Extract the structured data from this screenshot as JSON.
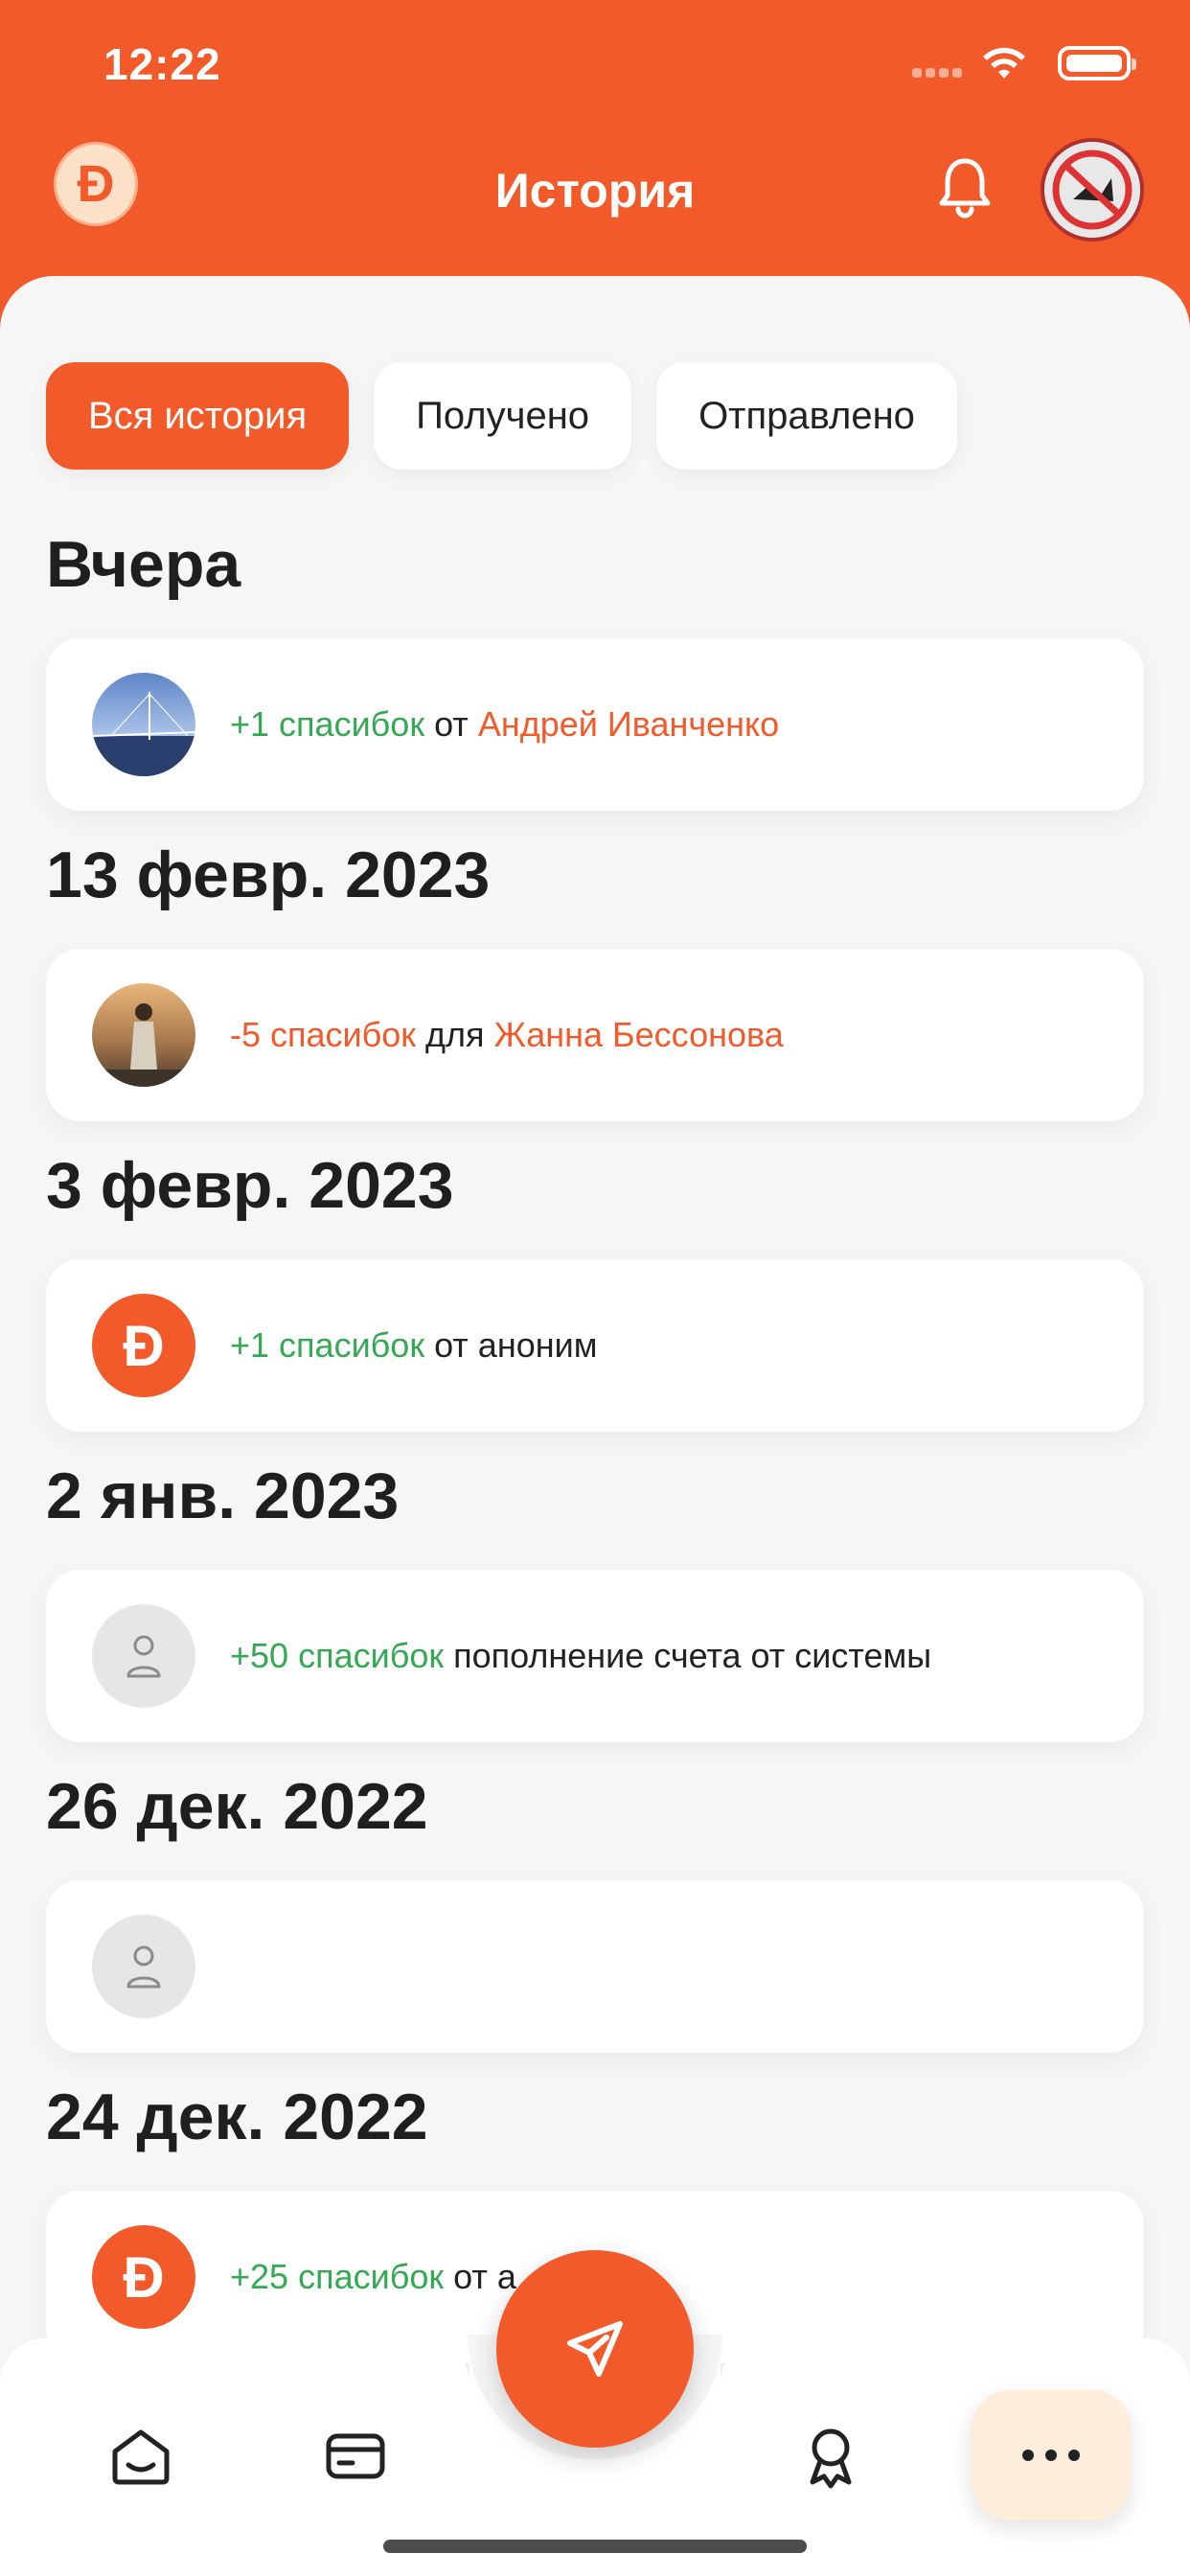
{
  "status": {
    "time": "12:22"
  },
  "header": {
    "title": "История",
    "logo_letter": "Đ"
  },
  "filters": [
    {
      "label": "Вся история",
      "active": true
    },
    {
      "label": "Получено",
      "active": false
    },
    {
      "label": "Отправлено",
      "active": false
    }
  ],
  "history": [
    {
      "date": "Вчера",
      "amount": "+1 спасибок",
      "prep": "от",
      "name": "Андрей Иванченко"
    },
    {
      "date": "13 февр. 2023",
      "amount": "-5 спасибок",
      "prep": "для",
      "name": "Жанна Бессонова"
    },
    {
      "date": "3 февр. 2023",
      "amount": "+1 спасибок",
      "prep": "от аноним",
      "name": ""
    },
    {
      "date": "2 янв. 2023",
      "amount": "+50 спасибок",
      "prep": "пополнение счета от системы",
      "name": ""
    },
    {
      "date": "26 дек. 2022",
      "amount": "",
      "prep": "",
      "name": ""
    },
    {
      "date": "24 дек. 2022",
      "amount": "+25 спасибок",
      "prep": "от а",
      "name": ""
    }
  ],
  "colors": {
    "accent": "#F25A2A",
    "positive": "#34A853",
    "background": "#F6F6F6"
  },
  "tabbar": {
    "icons": [
      "home-icon",
      "card-icon",
      "send-icon",
      "award-icon",
      "more-icon"
    ]
  }
}
